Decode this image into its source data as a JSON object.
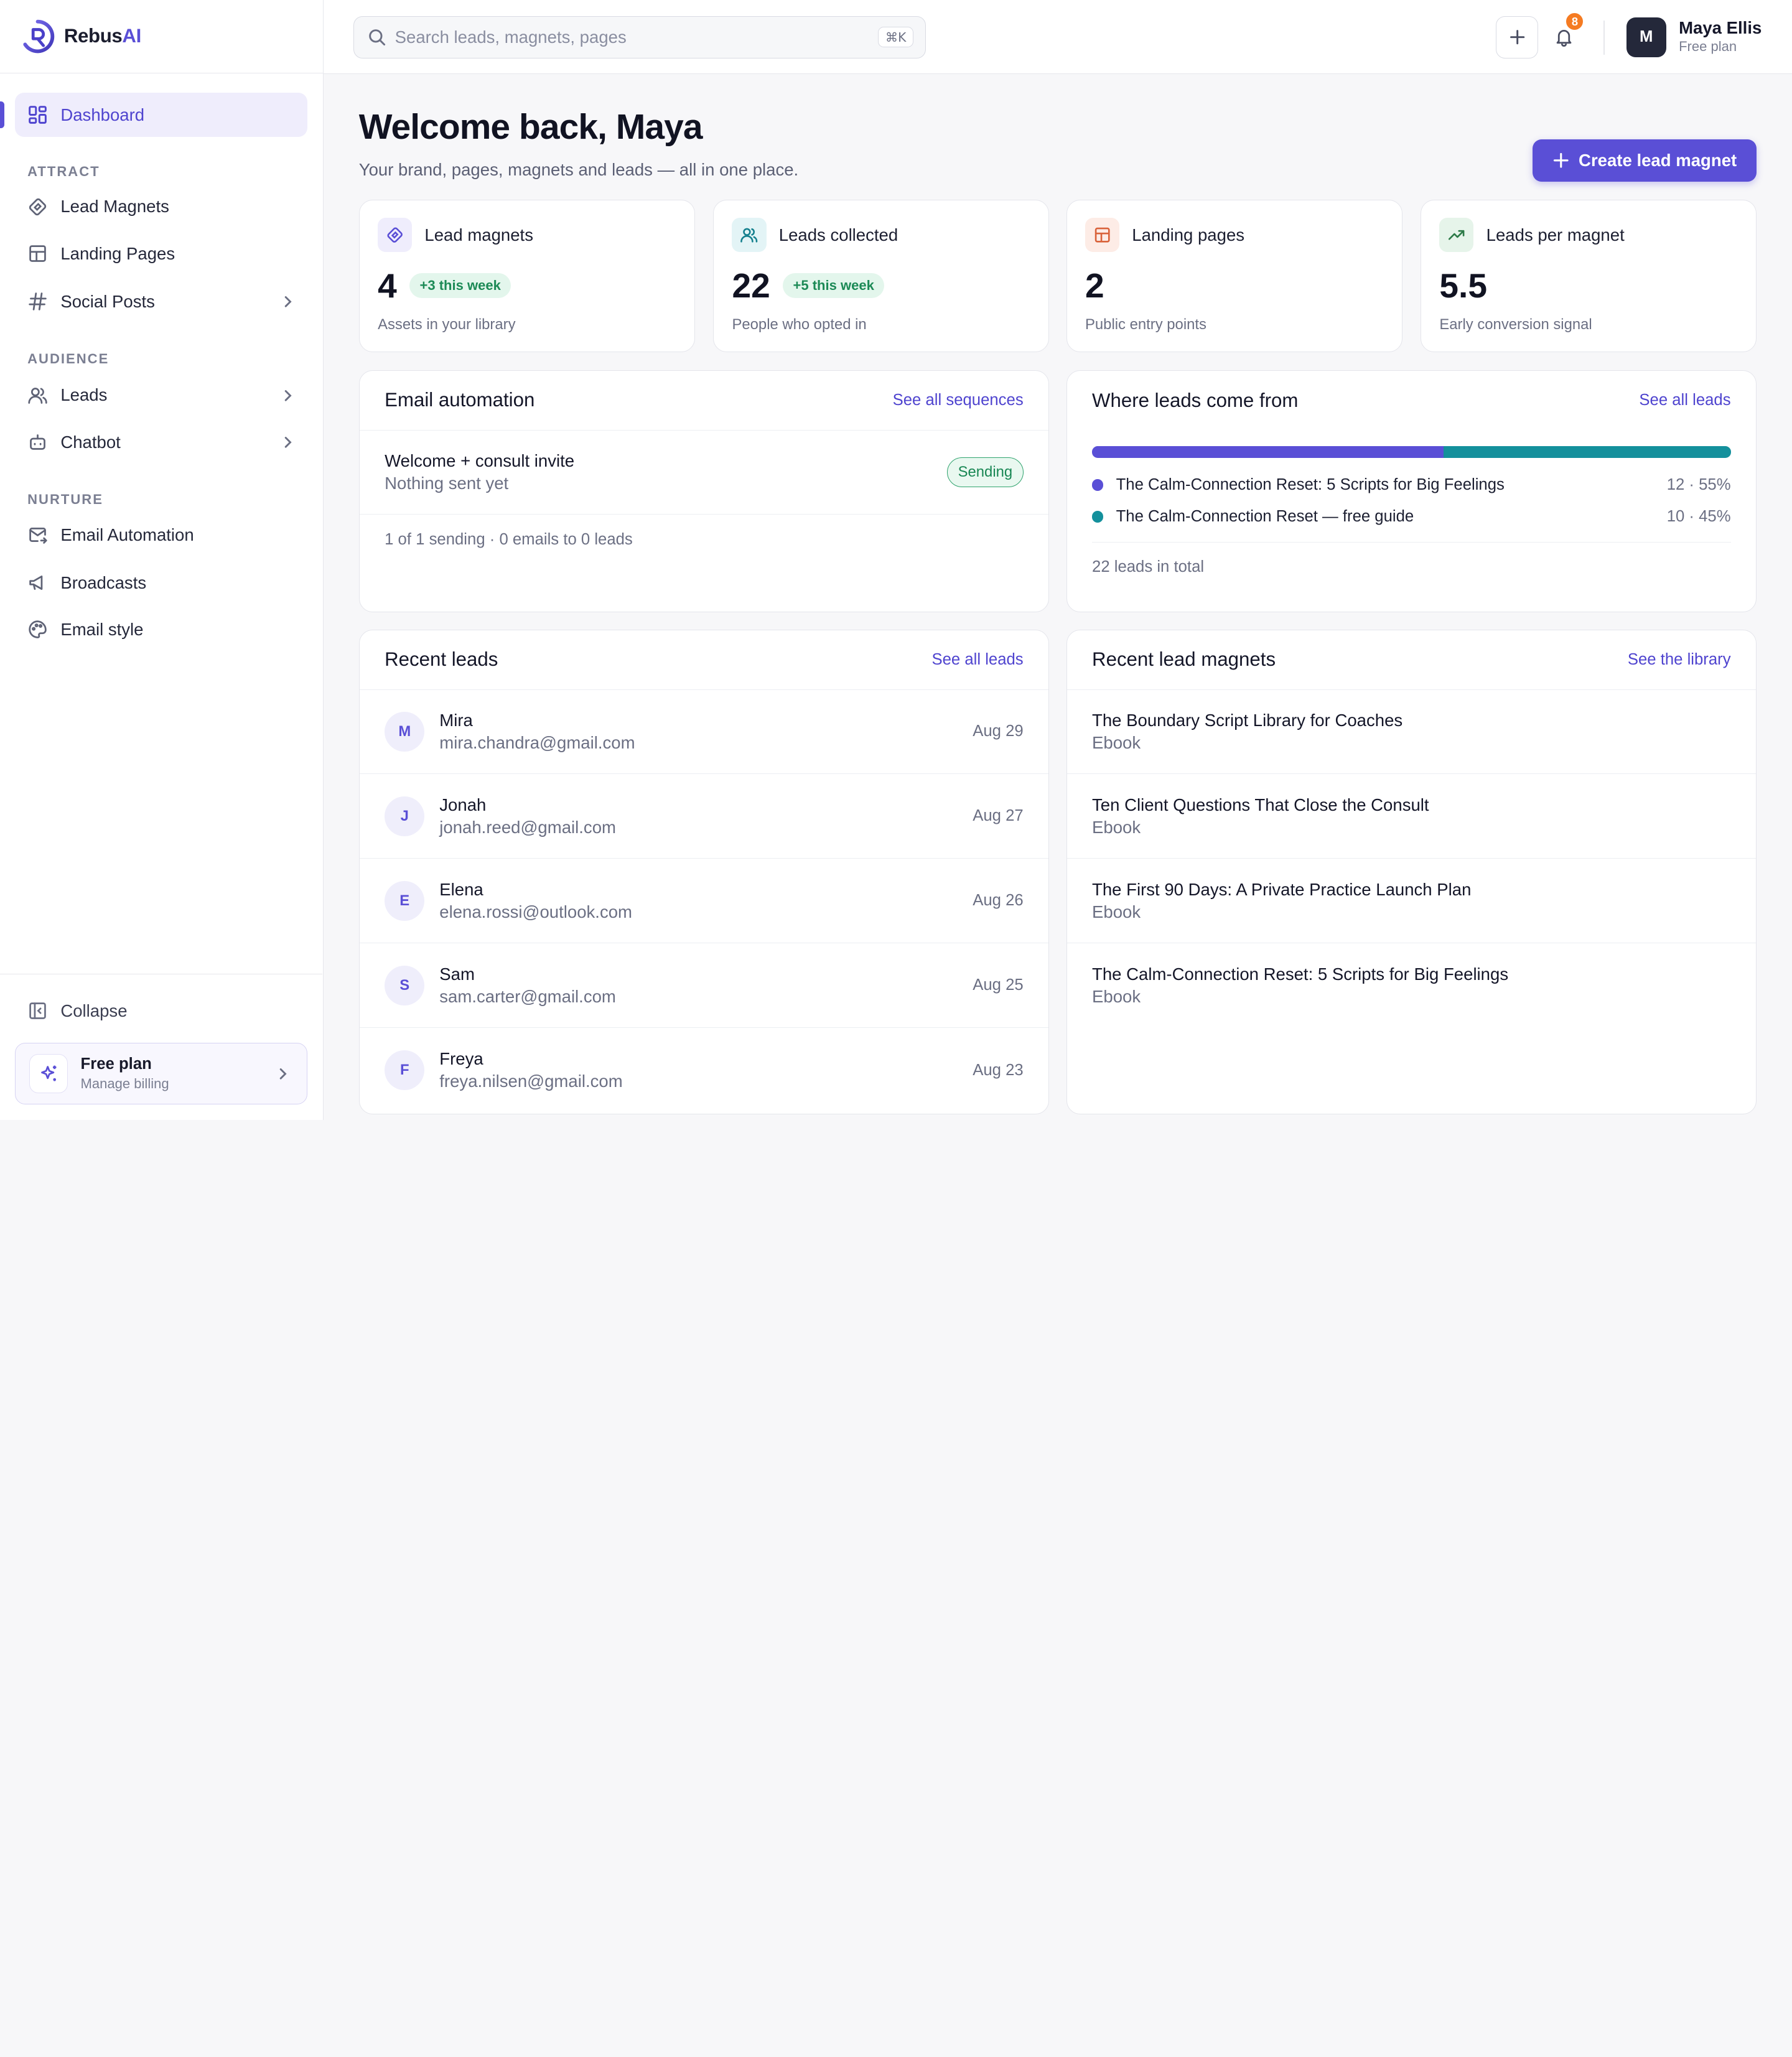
{
  "brand": {
    "name": "Rebus",
    "name_accent": "AI"
  },
  "sidebar": {
    "active": {
      "label": "Dashboard",
      "icon": "dashboard-grid-icon"
    },
    "sections": [
      {
        "heading": "ATTRACT",
        "items": [
          {
            "label": "Lead Magnets",
            "icon": "magnet-icon",
            "has_children": false
          },
          {
            "label": "Landing Pages",
            "icon": "layout-icon",
            "has_children": false
          },
          {
            "label": "Social Posts",
            "icon": "hash-icon",
            "has_children": true
          }
        ]
      },
      {
        "heading": "AUDIENCE",
        "items": [
          {
            "label": "Leads",
            "icon": "users-icon",
            "has_children": true
          },
          {
            "label": "Chatbot",
            "icon": "bot-icon",
            "has_children": true
          }
        ]
      },
      {
        "heading": "NURTURE",
        "items": [
          {
            "label": "Email Automation",
            "icon": "mail-send-icon",
            "has_children": false
          },
          {
            "label": "Broadcasts",
            "icon": "megaphone-icon",
            "has_children": false
          },
          {
            "label": "Email style",
            "icon": "palette-icon",
            "has_children": false
          }
        ]
      }
    ],
    "collapse_label": "Collapse",
    "plan": {
      "title": "Free plan",
      "subtitle": "Manage billing"
    }
  },
  "topbar": {
    "search_placeholder": "Search leads, magnets, pages",
    "shortcut": "⌘K",
    "notifications_count": "8",
    "user": {
      "initial": "M",
      "name": "Maya Ellis",
      "plan": "Free plan"
    }
  },
  "main": {
    "welcome": "Welcome back, Maya",
    "subtitle": "Your brand, pages, magnets and leads — all in one place.",
    "cta_label": "Create lead magnet",
    "stats": [
      {
        "title": "Lead magnets",
        "value": "4",
        "pill": "+3 this week",
        "sub": "Assets in your library",
        "icon": "magnet-icon",
        "icon_bg": "#efedfc",
        "icon_color": "#5a4fd6"
      },
      {
        "title": "Leads collected",
        "value": "22",
        "pill": "+5 this week",
        "sub": "People who opted in",
        "icon": "users-icon",
        "icon_bg": "#e3f4f6",
        "icon_color": "#14808e"
      },
      {
        "title": "Landing pages",
        "value": "2",
        "pill": "",
        "sub": "Public entry points",
        "icon": "layout-icon",
        "icon_bg": "#fdece6",
        "icon_color": "#d9623a"
      },
      {
        "title": "Leads per magnet",
        "value": "5.5",
        "pill": "",
        "sub": "Early conversion signal",
        "icon": "trending-up-icon",
        "icon_bg": "#e6f4ea",
        "icon_color": "#2c7a47"
      }
    ],
    "email_automation": {
      "title": "Email automation",
      "link": "See all sequences",
      "sequence_title": "Welcome + consult invite",
      "sequence_sub": "Nothing sent yet",
      "status": "Sending",
      "summary": "1 of 1 sending · 0 emails to 0 leads"
    },
    "lead_sources": {
      "title": "Where leads come from",
      "link": "See all leads",
      "sources": [
        {
          "label": "The Calm-Connection Reset: 5 Scripts for Big Feelings",
          "value": "12 · 55%",
          "share": 0.55,
          "color": "#5a4fd6"
        },
        {
          "label": "The Calm-Connection Reset — free guide",
          "value": "10 · 45%",
          "share": 0.45,
          "color": "#14909c"
        }
      ],
      "total": "22 leads in total"
    },
    "recent_leads": {
      "title": "Recent leads",
      "link": "See all leads",
      "rows": [
        {
          "initial": "M",
          "name": "Mira",
          "email": "mira.chandra@gmail.com",
          "date": "Aug 29"
        },
        {
          "initial": "J",
          "name": "Jonah",
          "email": "jonah.reed@gmail.com",
          "date": "Aug 27"
        },
        {
          "initial": "E",
          "name": "Elena",
          "email": "elena.rossi@outlook.com",
          "date": "Aug 26"
        },
        {
          "initial": "S",
          "name": "Sam",
          "email": "sam.carter@gmail.com",
          "date": "Aug 25"
        },
        {
          "initial": "F",
          "name": "Freya",
          "email": "freya.nilsen@gmail.com",
          "date": "Aug 23"
        }
      ]
    },
    "recent_magnets": {
      "title": "Recent lead magnets",
      "link": "See the library",
      "rows": [
        {
          "title": "The Boundary Script Library for Coaches",
          "type": "Ebook"
        },
        {
          "title": "Ten Client Questions That Close the Consult",
          "type": "Ebook"
        },
        {
          "title": "The First 90 Days: A Private Practice Launch Plan",
          "type": "Ebook"
        },
        {
          "title": "The Calm-Connection Reset: 5 Scripts for Big Feelings",
          "type": "Ebook"
        }
      ]
    }
  }
}
